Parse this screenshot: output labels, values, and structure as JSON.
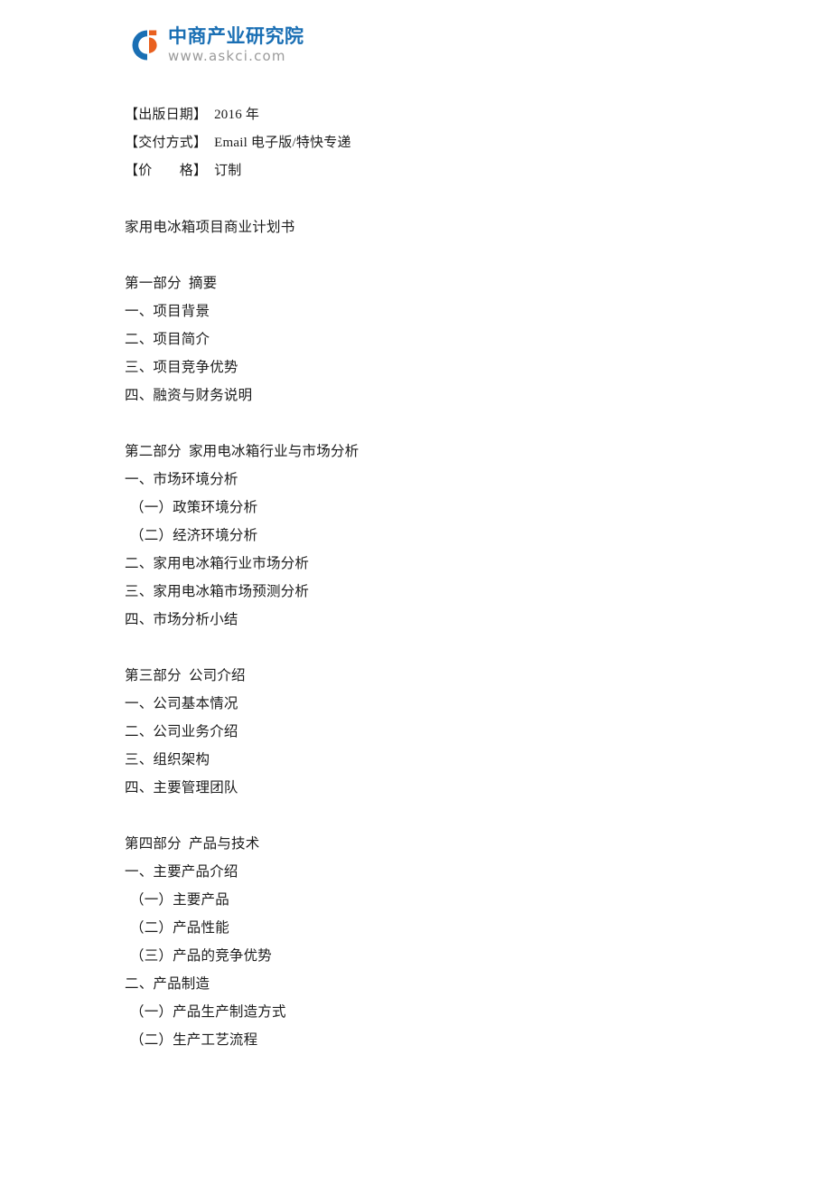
{
  "logo": {
    "mark_icon": "askci-c-logo-icon",
    "company_cn": "中商产业研究院",
    "website": "www.askci.com",
    "brand_blue": "#1a6fb4",
    "brand_orange": "#e9601f",
    "url_gray": "#9a9a9a"
  },
  "meta": [
    {
      "label": "【出版日期】",
      "value": "2016 年"
    },
    {
      "label": "【交付方式】",
      "value": "Email 电子版/特快专递"
    },
    {
      "label": "【价　　格】",
      "value": "订制"
    }
  ],
  "title": "家用电冰箱项目商业计划书",
  "sections": [
    {
      "heading": "第一部分  摘要",
      "items": [
        "一、项目背景",
        "二、项目简介",
        "三、项目竞争优势",
        "四、融资与财务说明"
      ]
    },
    {
      "heading": "第二部分  家用电冰箱行业与市场分析",
      "items": [
        "一、市场环境分析",
        "（一）政策环境分析",
        "（二）经济环境分析",
        "二、家用电冰箱行业市场分析",
        "三、家用电冰箱市场预测分析",
        "四、市场分析小结"
      ],
      "sub_flags": [
        false,
        true,
        true,
        false,
        false,
        false
      ]
    },
    {
      "heading": "第三部分  公司介绍",
      "items": [
        "一、公司基本情况",
        "二、公司业务介绍",
        "三、组织架构",
        "四、主要管理团队"
      ]
    },
    {
      "heading": "第四部分  产品与技术",
      "items": [
        "一、主要产品介绍",
        "（一）主要产品",
        "（二）产品性能",
        "（三）产品的竞争优势",
        "二、产品制造",
        "（一）产品生产制造方式",
        "（二）生产工艺流程"
      ],
      "sub_flags": [
        false,
        true,
        true,
        true,
        false,
        true,
        true
      ]
    }
  ]
}
